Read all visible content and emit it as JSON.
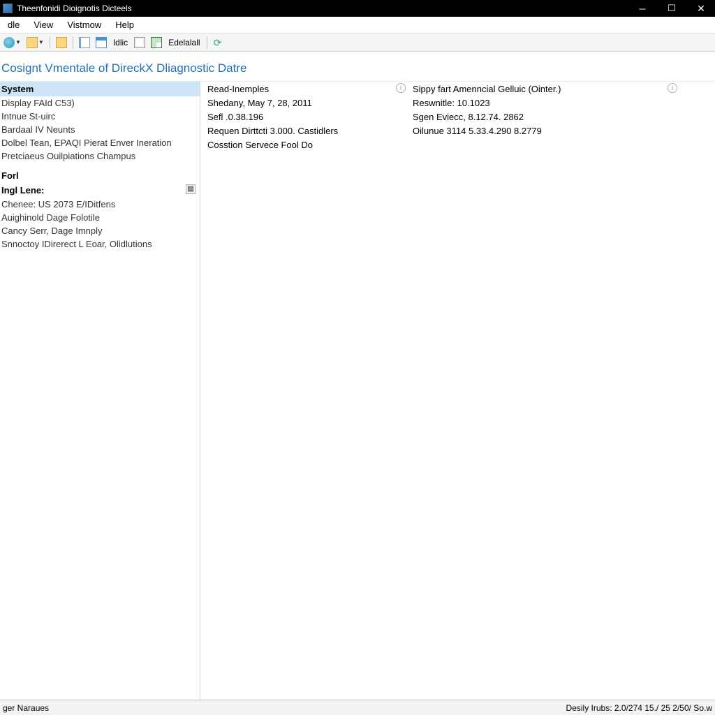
{
  "window": {
    "title": "Theenfonidi Dioignotis Dicteels"
  },
  "menu": {
    "items": [
      "dle",
      "View",
      "Vistmow",
      "Help"
    ]
  },
  "toolbar": {
    "label_idlic": "Idlic",
    "label_edelalall": "Edelalall"
  },
  "heading": "Cosignt Vmentale of DireckX Dliagnostic Datre",
  "sidebar": {
    "group1_head": "System",
    "group1_items": [
      "Display FAId C53)",
      "Intnue St-uirc",
      "Bardaal IV Neunts",
      "Dolbel Tean, EPAQI Pierat Enver Ineration",
      "Pretciaeus Ouilpiations Champus"
    ],
    "group2_head": "Forl",
    "group2_head2": "Ingl Lene:",
    "group2_items": [
      "Chenee: US 2073 E/IDitfens",
      "Auighinold Dage Folotile",
      "Cancy Serr, Dage Imnply",
      "Snnoctoy IDirerect L Eoar, Olidlutions"
    ]
  },
  "details": {
    "col1": [
      "Read-Inemples",
      "Shedany, May 7, 28, 2011",
      "Sefl .0.38.196",
      "Requen Dirttcti 3.000. Castidlers",
      "Cosstion Servece Fool Do"
    ],
    "col2_head": "Sippy fart Amenncial Gelluic (Ointer.)",
    "col2": [
      "Reswnitle: 10.1023",
      "Sgen Eviecc, 8.12.74. 2862",
      "Oilunue 3114 5.33.4.290 8.2779"
    ]
  },
  "statusbar": {
    "left": "ger Naraues",
    "right": "Desily Irubs: 2.0/274 15./ 25 2/50/ So.w"
  }
}
